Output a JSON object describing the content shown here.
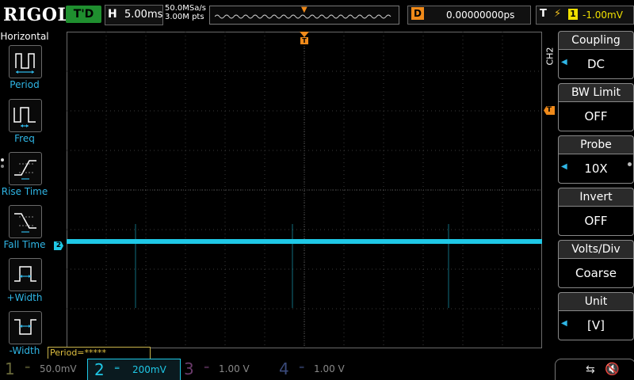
{
  "header": {
    "brand": "RIGOL",
    "run_state": "T'D",
    "horizontal_label": "H",
    "timebase": "5.00ms",
    "sample_rate": "50.0MSa/s",
    "memory_depth": "3.00M pts",
    "delay_label": "D",
    "delay_value": "0.00000000ps",
    "trigger_label": "T",
    "trigger_source": "1",
    "trigger_level": "-1.00mV"
  },
  "left_menu": {
    "title": "Horizontal",
    "items": [
      {
        "label": "Period",
        "icon": "period-icon"
      },
      {
        "label": "Freq",
        "icon": "freq-icon"
      },
      {
        "label": "Rise Time",
        "icon": "rise-time-icon"
      },
      {
        "label": "Fall Time",
        "icon": "fall-time-icon"
      },
      {
        "label": "+Width",
        "icon": "pos-width-icon"
      },
      {
        "label": "-Width",
        "icon": "neg-width-icon"
      }
    ]
  },
  "right_menu": {
    "channel": "CH2",
    "items": [
      {
        "title": "Coupling",
        "value": "DC"
      },
      {
        "title": "BW Limit",
        "value": "OFF"
      },
      {
        "title": "Probe",
        "value": "10X"
      },
      {
        "title": "Invert",
        "value": "OFF"
      },
      {
        "title": "Volts/Div",
        "value": "Coarse"
      },
      {
        "title": "Unit",
        "value": "[V]"
      }
    ]
  },
  "display": {
    "ch2_marker": "2",
    "trigger_marker": "T",
    "measurement": "Period=*****",
    "trace_color": "#1fc8e6"
  },
  "channels": [
    {
      "num": "1",
      "scale": "50.0mV"
    },
    {
      "num": "2",
      "scale": "200mV"
    },
    {
      "num": "3",
      "scale": "1.00 V"
    },
    {
      "num": "4",
      "scale": "1.00 V"
    }
  ]
}
